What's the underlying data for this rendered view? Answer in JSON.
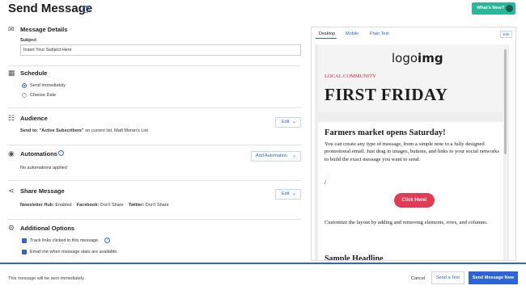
{
  "header": {
    "title": "Send Message",
    "whats_new": "What's New?"
  },
  "message_details": {
    "title": "Message Details",
    "subject_label": "Subject",
    "subject_placeholder": "Insert Your Subject Here"
  },
  "schedule": {
    "title": "Schedule",
    "option_immediately": "Send Immediately",
    "option_date": "Choose Date",
    "selected": "Send Immediately"
  },
  "audience": {
    "title": "Audience",
    "send_to_label": "Send to:",
    "send_to_value": "\"Active Subscribers\"",
    "send_to_rest": "on current list, Matt Moran's List",
    "edit_label": "Edit"
  },
  "automations": {
    "title": "Automations",
    "status": "No automations applied",
    "add_label": "Add Automation"
  },
  "share": {
    "title": "Share Message",
    "newsletter_label": "Newsletter Hub:",
    "newsletter_value": "Enabled",
    "facebook_label": "Facebook:",
    "facebook_value": "Don't Share",
    "twitter_label": "Twitter:",
    "twitter_value": "Don't Share",
    "edit_label": "Edit"
  },
  "additional": {
    "title": "Additional Options",
    "track_links": "Track links clicked in this message.",
    "email_stats": "Email me when message stats are available."
  },
  "preview": {
    "tabs": [
      "Desktop",
      "Mobile",
      "Plain Text"
    ],
    "active_tab": "Desktop",
    "edit_label": "Edit",
    "logo_light": "logo",
    "logo_bold": "img",
    "kicker": "LOCAL COMMUNITY",
    "headline": "FIRST FRIDAY",
    "body_heading": "Farmers market opens Saturday!",
    "body_text_1": "You can create any type of message, from a simple note to a fully designed promotional email. Just drag in images, buttons, and links to your social networks to build the exact message you want to send.",
    "slash": "/",
    "cta": "Click Here!",
    "body_text_2": "Customize the layout by adding and removing elements, rows, and columns.",
    "sample_headline": "Sample Headline"
  },
  "footer": {
    "status": "This message will be sent immediately.",
    "cancel": "Cancel",
    "send_test": "Send a Test",
    "send_now": "Send Message Now"
  },
  "colors": {
    "accent": "#2b65d9",
    "whats_new_bg": "#27b89a",
    "cta_bg": "#e43b55",
    "kicker": "#c8244f"
  }
}
